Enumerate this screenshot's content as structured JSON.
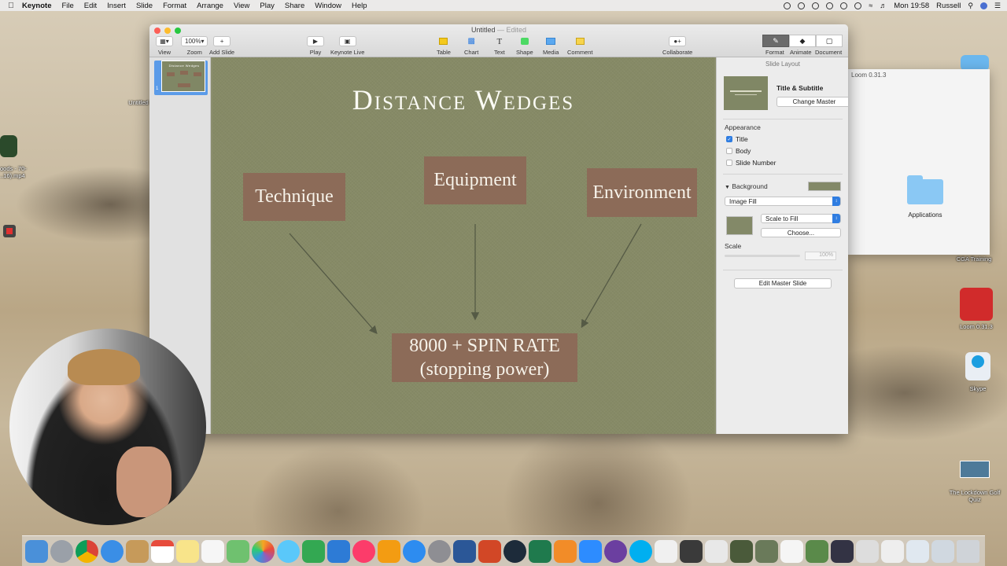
{
  "menubar": {
    "app_name": "Keynote",
    "items": [
      "File",
      "Edit",
      "Insert",
      "Slide",
      "Format",
      "Arrange",
      "View",
      "Play",
      "Share",
      "Window",
      "Help"
    ],
    "clock": "Mon 19:58",
    "user": "Russell"
  },
  "window": {
    "title": "Untitled",
    "edited": " — Edited",
    "toolbar": {
      "view": "View",
      "zoom": "Zoom",
      "zoom_value": "100%",
      "add_slide": "Add Slide",
      "play": "Play",
      "keynote_live": "Keynote Live",
      "table": "Table",
      "chart": "Chart",
      "text": "Text",
      "shape": "Shape",
      "media": "Media",
      "comment": "Comment",
      "collaborate": "Collaborate",
      "format": "Format",
      "animate": "Animate",
      "document": "Document"
    }
  },
  "navigator": {
    "slide_number": "1",
    "thumb_title": "Distance Wedges"
  },
  "slide": {
    "title": "Distance Wedges",
    "boxes": {
      "technique": "Technique",
      "equipment": "Equipment",
      "environment": "Environment",
      "spin_line1": "8000 + SPIN RATE",
      "spin_line2": "(stopping power)"
    }
  },
  "inspector": {
    "header": "Slide Layout",
    "layout_name": "Title & Subtitle",
    "change_master": "Change Master",
    "appearance": "Appearance",
    "checkboxes": [
      {
        "label": "Title",
        "checked": true
      },
      {
        "label": "Body",
        "checked": false
      },
      {
        "label": "Slide Number",
        "checked": false
      }
    ],
    "background": "Background",
    "background_color": "#838968",
    "fill_type": "Image Fill",
    "scale_mode": "Scale to Fill",
    "choose": "Choose...",
    "scale": "Scale",
    "scale_value": "100%",
    "edit_master": "Edit Master Slide"
  },
  "finder": {
    "title": "Loom 0.31.3",
    "folder": "Applications"
  },
  "desktop": {
    "file_left_top": "Untitled",
    "file_left": "oods - 70-\n..16).mp4",
    "cga": "CGA Training",
    "loom": "Loom 0.31.3",
    "skype": "Skype",
    "quiz": "The Lockdown Golf\nQuiz"
  },
  "colors": {
    "slide_bg": "#868a66",
    "box_fill": "#8c6b58",
    "accent": "#2f7de1"
  }
}
